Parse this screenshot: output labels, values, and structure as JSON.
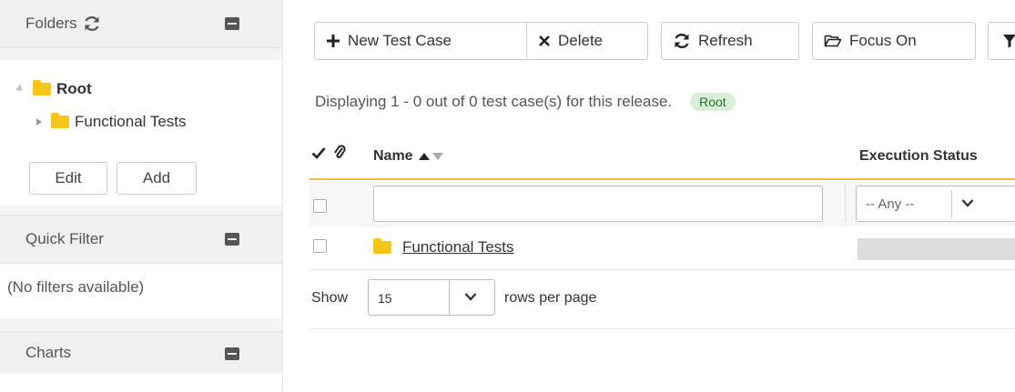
{
  "sidebar": {
    "folders_title": "Folders",
    "tree": [
      {
        "label": "Root",
        "bold": true
      },
      {
        "label": "Functional Tests",
        "bold": false
      }
    ],
    "edit_label": "Edit",
    "add_label": "Add",
    "quick_filter_title": "Quick Filter",
    "no_filters_text": "(No filters available)",
    "charts_title": "Charts"
  },
  "toolbar": {
    "new_label": "New Test Case",
    "delete_label": "Delete",
    "refresh_label": "Refresh",
    "focus_label": "Focus On"
  },
  "main": {
    "status_text": "Displaying 1 - 0 out of 0 test case(s) for this release.",
    "root_badge": "Root",
    "columns": {
      "name": "Name",
      "execution_status": "Execution Status"
    },
    "status_filter_value": "-- Any --",
    "rows": [
      {
        "name": "Functional Tests",
        "type": "folder"
      }
    ],
    "pager": {
      "show_label": "Show",
      "rows_value": "15",
      "rows_per_page_label": "rows per page"
    }
  },
  "colors": {
    "folder": "#f5c518",
    "header_underline": "#f0c040",
    "root_badge_bg": "#d9efd9"
  }
}
